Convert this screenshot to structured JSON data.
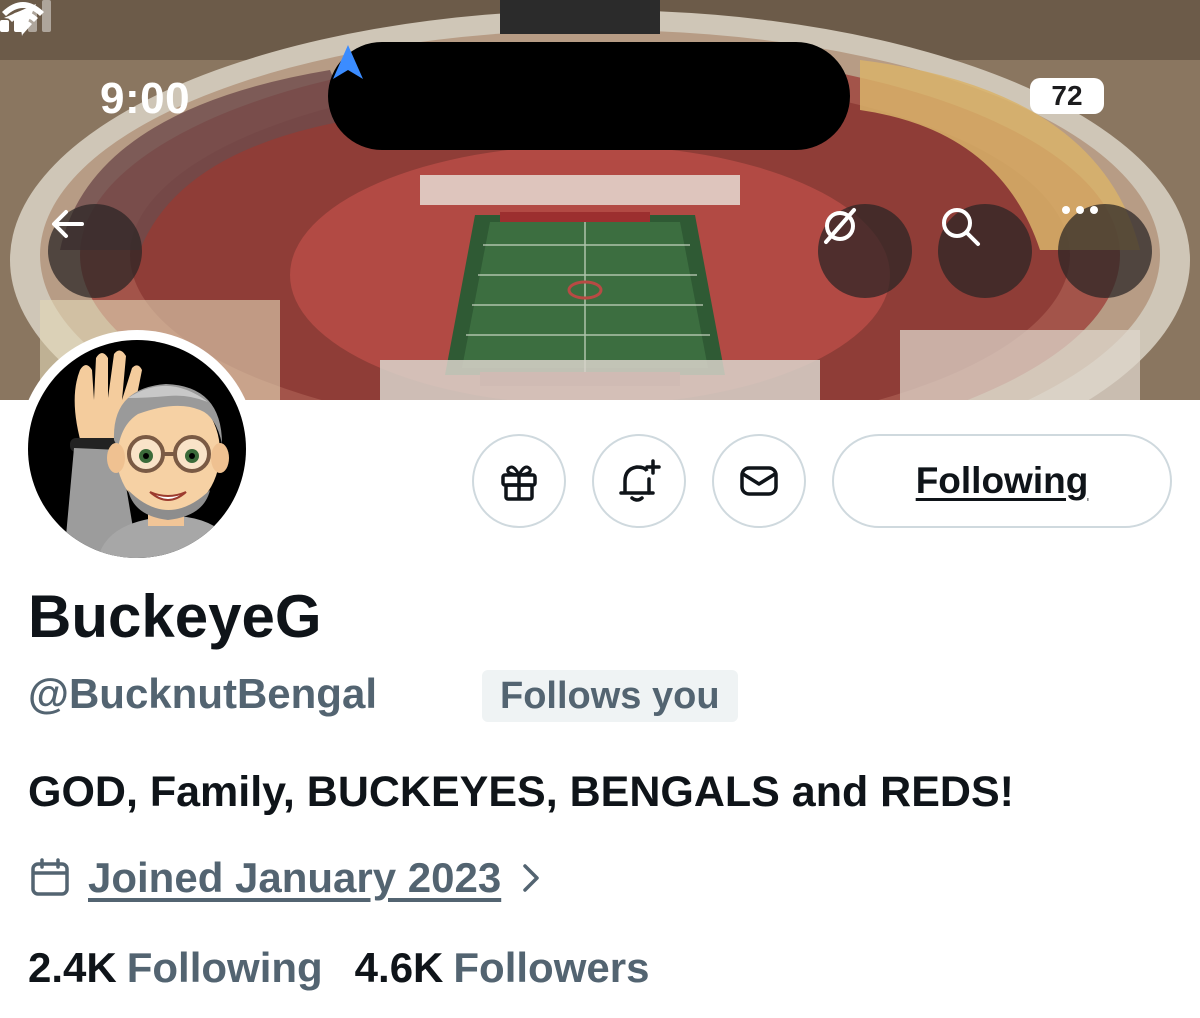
{
  "status_bar": {
    "time": "9:00",
    "battery": "72",
    "location_icon": "location-arrow-icon",
    "signal_icon": "cellular-signal-icon",
    "wifi_icon": "wifi-icon"
  },
  "header_buttons": {
    "back": "back-arrow-icon",
    "grok": "grok-icon",
    "search": "search-icon",
    "more": "more-icon"
  },
  "actions": {
    "gift_icon": "gift-icon",
    "notify_icon": "bell-plus-icon",
    "message_icon": "mail-icon",
    "following_label": "Following"
  },
  "profile": {
    "display_name": "BuckeyeG",
    "handle": "@BucknutBengal",
    "follows_you": "Follows you",
    "bio": "GOD, Family, BUCKEYES, BENGALS and REDS!",
    "joined": "Joined January 2023",
    "stats": {
      "following_count": "2.4K",
      "following_label": "Following",
      "followers_count": "4.6K",
      "followers_label": "Followers"
    }
  },
  "colors": {
    "primary_text": "#0f1419",
    "secondary_text": "#536471",
    "border": "#cfd9de",
    "badge_bg": "#eff3f4",
    "nav_blue": "#3b8cff"
  }
}
